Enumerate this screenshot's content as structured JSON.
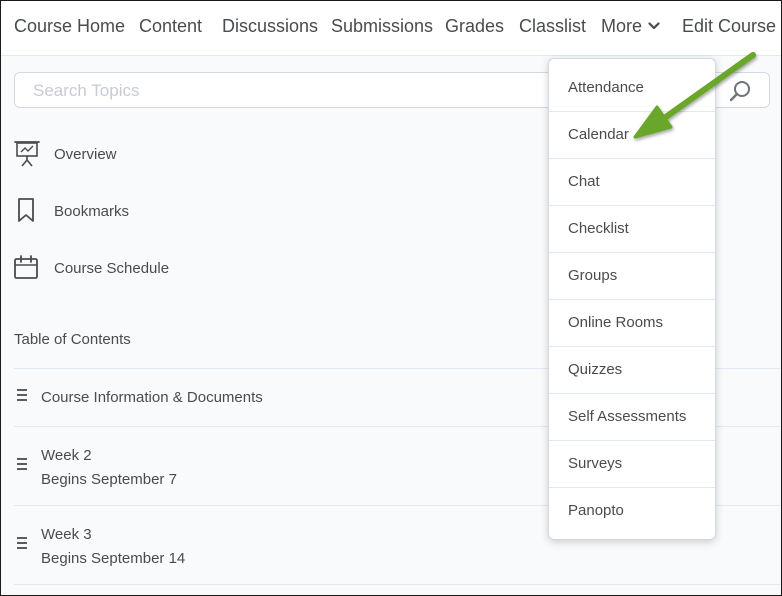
{
  "nav": {
    "items": [
      {
        "label": "Course Home"
      },
      {
        "label": "Content"
      },
      {
        "label": "Discussions"
      },
      {
        "label": "Submissions"
      },
      {
        "label": "Grades"
      },
      {
        "label": "Classlist"
      },
      {
        "label": "More"
      },
      {
        "label": "Edit Course"
      }
    ]
  },
  "search": {
    "placeholder": "Search Topics",
    "value": ""
  },
  "topics": [
    {
      "label": "Overview",
      "icon": "presentation-board-icon"
    },
    {
      "label": "Bookmarks",
      "icon": "bookmark-icon"
    },
    {
      "label": "Course Schedule",
      "icon": "calendar-icon"
    }
  ],
  "toc": {
    "title": "Table of Contents",
    "items": [
      {
        "title": "Course Information & Documents",
        "subtitle": ""
      },
      {
        "title": "Week 2",
        "subtitle": "Begins September 7"
      },
      {
        "title": "Week 3",
        "subtitle": "Begins September 14"
      }
    ]
  },
  "more_menu": {
    "items": [
      {
        "label": "Attendance"
      },
      {
        "label": "Calendar"
      },
      {
        "label": "Chat"
      },
      {
        "label": "Checklist"
      },
      {
        "label": "Groups"
      },
      {
        "label": "Online Rooms"
      },
      {
        "label": "Quizzes"
      },
      {
        "label": "Self Assessments"
      },
      {
        "label": "Surveys"
      },
      {
        "label": "Panopto"
      }
    ]
  },
  "colors": {
    "text": "#494c4e",
    "arrow": "#6aa62c",
    "border": "#d3d9e3"
  }
}
